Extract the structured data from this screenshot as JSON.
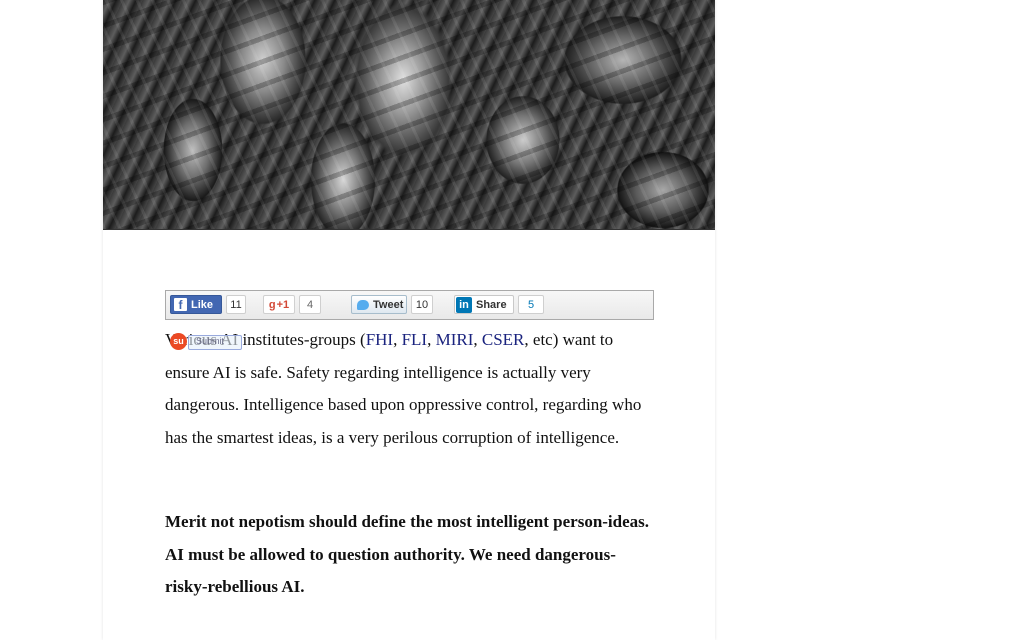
{
  "share": {
    "facebook": {
      "label": "Like",
      "icon": "f",
      "count": "11"
    },
    "googleplus": {
      "label": "+1",
      "icon": "g",
      "count": "4"
    },
    "twitter": {
      "label": "Tweet",
      "count": "10"
    },
    "linkedin": {
      "label": "Share",
      "icon": "in",
      "count": "5"
    },
    "stumbleupon": {
      "label": "Submit",
      "icon": "su"
    }
  },
  "article": {
    "p1_pre": "Various AI institutes-groups (",
    "links": [
      "FHI",
      "FLI",
      "MIRI",
      "CSER"
    ],
    "sep": ", ",
    "p1_mid": ", etc) want to ensure AI is safe. Safety regarding intelligence is actually very dangerous. Intelligence based upon oppressive control, regarding who has the smartest ideas, is a very perilous corruption of intelligence.",
    "p2": "Merit not nepotism should define the most intelligent person-ideas. AI must be allowed to question authority. We need dangerous-risky-rebellious AI."
  },
  "colors": {
    "link": "#1a237e",
    "facebook": "#4267b2",
    "linkedin": "#0077b5",
    "stumbleupon": "#eb4924"
  }
}
